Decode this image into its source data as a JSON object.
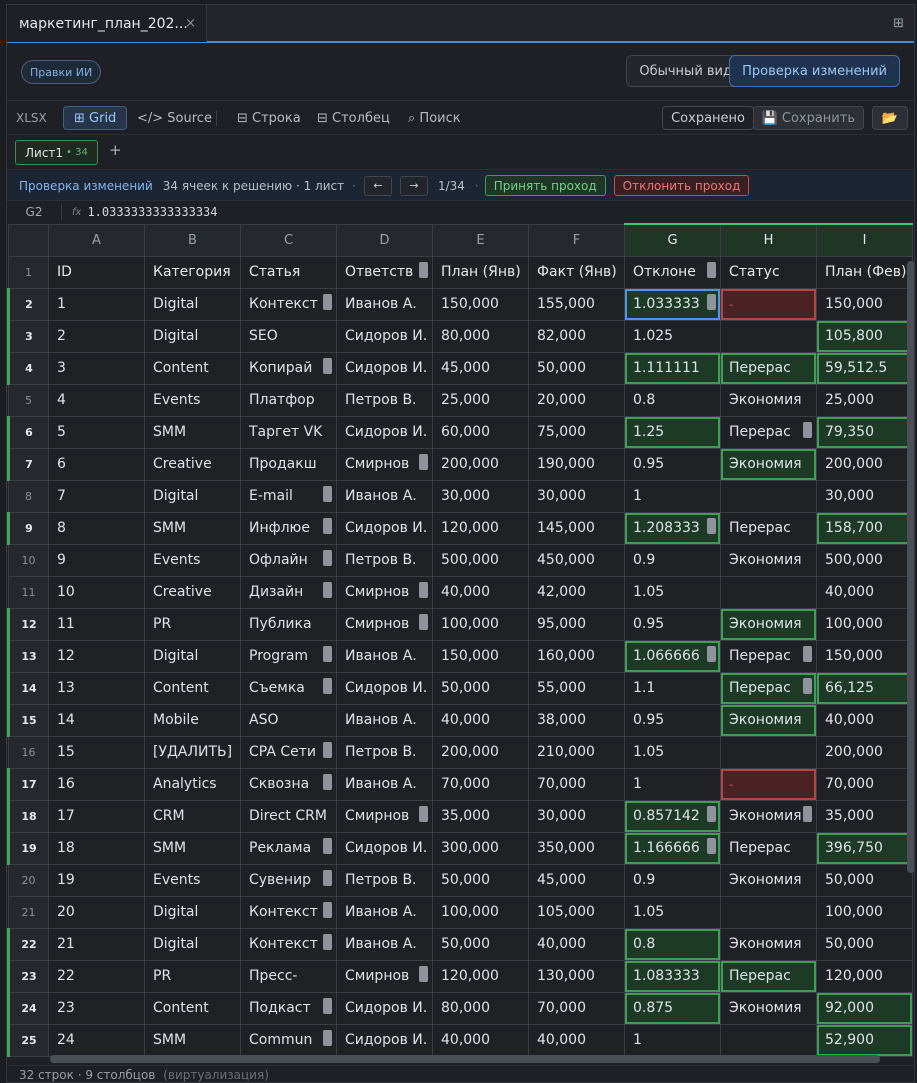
{
  "tab": {
    "filename": "маркетинг_план_202...",
    "close": "×",
    "panel_icon": "⊞"
  },
  "mode": {
    "ai_edits": "Правки ИИ",
    "normal_view": "Обычный вид",
    "review_changes": "Проверка изменений"
  },
  "toolbar": {
    "format": "XLSX",
    "grid": "⊞ Grid",
    "source": "</> Source",
    "row": "⊟ Строка",
    "column": "⊟ Столбец",
    "search": "⌕ Поиск",
    "saved": "Сохранено",
    "save": "💾 Сохранить",
    "open_icon": "📂"
  },
  "sheets": [
    {
      "name": "Лист1",
      "count": "• 34"
    }
  ],
  "add_sheet": "+",
  "review": {
    "title": "Проверка изменений",
    "info": "34 ячеек к решению · 1 лист",
    "prev": "←",
    "next": "→",
    "position": "1/34",
    "accept": "Принять проход",
    "reject": "Отклонить проход"
  },
  "formula": {
    "cell_ref": "G2",
    "fx": "fx",
    "value": "1.0333333333333334"
  },
  "columns": [
    "A",
    "B",
    "C",
    "D",
    "E",
    "F",
    "G",
    "H",
    "I"
  ],
  "selected_columns": [
    "G",
    "H",
    "I"
  ],
  "header_row": [
    "ID",
    "Категория",
    "Статья",
    "Ответств",
    "План (Янв)",
    "Факт (Янв)",
    "Отклоне",
    "Статус",
    "План (Фев)"
  ],
  "rows": [
    {
      "n": "2",
      "changed": true,
      "cells": [
        "1",
        "Digital",
        "Контекст",
        "Иванов А.",
        "150,000",
        "155,000",
        "1.033333",
        "-",
        "150,000"
      ]
    },
    {
      "n": "3",
      "changed": true,
      "cells": [
        "2",
        "Digital",
        "SEO",
        "Сидоров И.",
        "80,000",
        "82,000",
        "1.025",
        "",
        "105,800"
      ]
    },
    {
      "n": "4",
      "changed": true,
      "cells": [
        "3",
        "Content",
        "Копирай",
        "Сидоров И.",
        "45,000",
        "50,000",
        "1.111111",
        "Перерас",
        "59,512.5"
      ]
    },
    {
      "n": "5",
      "changed": false,
      "cells": [
        "4",
        "Events",
        "Платфор",
        "Петров В.",
        "25,000",
        "20,000",
        "0.8",
        "Экономия",
        "25,000"
      ]
    },
    {
      "n": "6",
      "changed": true,
      "cells": [
        "5",
        "SMM",
        "Таргет VK",
        "Сидоров И.",
        "60,000",
        "75,000",
        "1.25",
        "Перерас",
        "79,350"
      ]
    },
    {
      "n": "7",
      "changed": true,
      "cells": [
        "6",
        "Creative",
        "Продакш",
        "Смирнов",
        "200,000",
        "190,000",
        "0.95",
        "Экономия",
        "200,000"
      ]
    },
    {
      "n": "8",
      "changed": false,
      "cells": [
        "7",
        "Digital",
        "E-mail",
        "Иванов А.",
        "30,000",
        "30,000",
        "1",
        "",
        "30,000"
      ]
    },
    {
      "n": "9",
      "changed": true,
      "cells": [
        "8",
        "SMM",
        "Инфлюе",
        "Сидоров И.",
        "120,000",
        "145,000",
        "1.208333",
        "Перерас",
        "158,700"
      ]
    },
    {
      "n": "10",
      "changed": false,
      "cells": [
        "9",
        "Events",
        "Офлайн",
        "Петров В.",
        "500,000",
        "450,000",
        "0.9",
        "Экономия",
        "500,000"
      ]
    },
    {
      "n": "11",
      "changed": false,
      "cells": [
        "10",
        "Creative",
        "Дизайн",
        "Смирнов",
        "40,000",
        "42,000",
        "1.05",
        "",
        "40,000"
      ]
    },
    {
      "n": "12",
      "changed": true,
      "cells": [
        "11",
        "PR",
        "Публика",
        "Смирнов",
        "100,000",
        "95,000",
        "0.95",
        "Экономия",
        "100,000"
      ]
    },
    {
      "n": "13",
      "changed": true,
      "cells": [
        "12",
        "Digital",
        "Program",
        "Иванов А.",
        "150,000",
        "160,000",
        "1.066666",
        "Перерас",
        "150,000"
      ]
    },
    {
      "n": "14",
      "changed": true,
      "cells": [
        "13",
        "Content",
        "Съемка",
        "Сидоров И.",
        "50,000",
        "55,000",
        "1.1",
        "Перерас",
        "66,125"
      ]
    },
    {
      "n": "15",
      "changed": true,
      "cells": [
        "14",
        "Mobile",
        "ASO",
        "Иванов А.",
        "40,000",
        "38,000",
        "0.95",
        "Экономия",
        "40,000"
      ]
    },
    {
      "n": "16",
      "changed": false,
      "cells": [
        "15",
        "[УДАЛИТЬ]",
        "CPA Сети",
        "Петров В.",
        "200,000",
        "210,000",
        "1.05",
        "",
        "200,000"
      ]
    },
    {
      "n": "17",
      "changed": true,
      "cells": [
        "16",
        "Analytics",
        "Сквозна",
        "Иванов А.",
        "70,000",
        "70,000",
        "1",
        "-",
        "70,000"
      ]
    },
    {
      "n": "18",
      "changed": true,
      "cells": [
        "17",
        "CRM",
        "Direct CRM",
        "Смирнов",
        "35,000",
        "30,000",
        "0.857142",
        "Экономия",
        "35,000"
      ]
    },
    {
      "n": "19",
      "changed": true,
      "cells": [
        "18",
        "SMM",
        "Реклама",
        "Сидоров И.",
        "300,000",
        "350,000",
        "1.166666",
        "Перерас",
        "396,750"
      ]
    },
    {
      "n": "20",
      "changed": false,
      "cells": [
        "19",
        "Events",
        "Сувенир",
        "Петров В.",
        "50,000",
        "45,000",
        "0.9",
        "Экономия",
        "50,000"
      ]
    },
    {
      "n": "21",
      "changed": false,
      "cells": [
        "20",
        "Digital",
        "Контекст",
        "Иванов А.",
        "100,000",
        "105,000",
        "1.05",
        "",
        "100,000"
      ]
    },
    {
      "n": "22",
      "changed": true,
      "cells": [
        "21",
        "Digital",
        "Контекст",
        "Иванов А.",
        "50,000",
        "40,000",
        "0.8",
        "Экономия",
        "50,000"
      ]
    },
    {
      "n": "23",
      "changed": true,
      "cells": [
        "22",
        "PR",
        "Пресс-",
        "Смирнов",
        "120,000",
        "130,000",
        "1.083333",
        "Перерас",
        "120,000"
      ]
    },
    {
      "n": "24",
      "changed": true,
      "cells": [
        "23",
        "Content",
        "Подкаст",
        "Сидоров И.",
        "80,000",
        "70,000",
        "0.875",
        "Экономия",
        "92,000"
      ]
    },
    {
      "n": "25",
      "changed": true,
      "cells": [
        "24",
        "SMM",
        "Commun",
        "Сидоров И.",
        "40,000",
        "40,000",
        "1",
        "",
        "52,900"
      ]
    }
  ],
  "status": {
    "summary": "32 строк · 9 столбцов",
    "virtual": "(виртуализация)"
  }
}
